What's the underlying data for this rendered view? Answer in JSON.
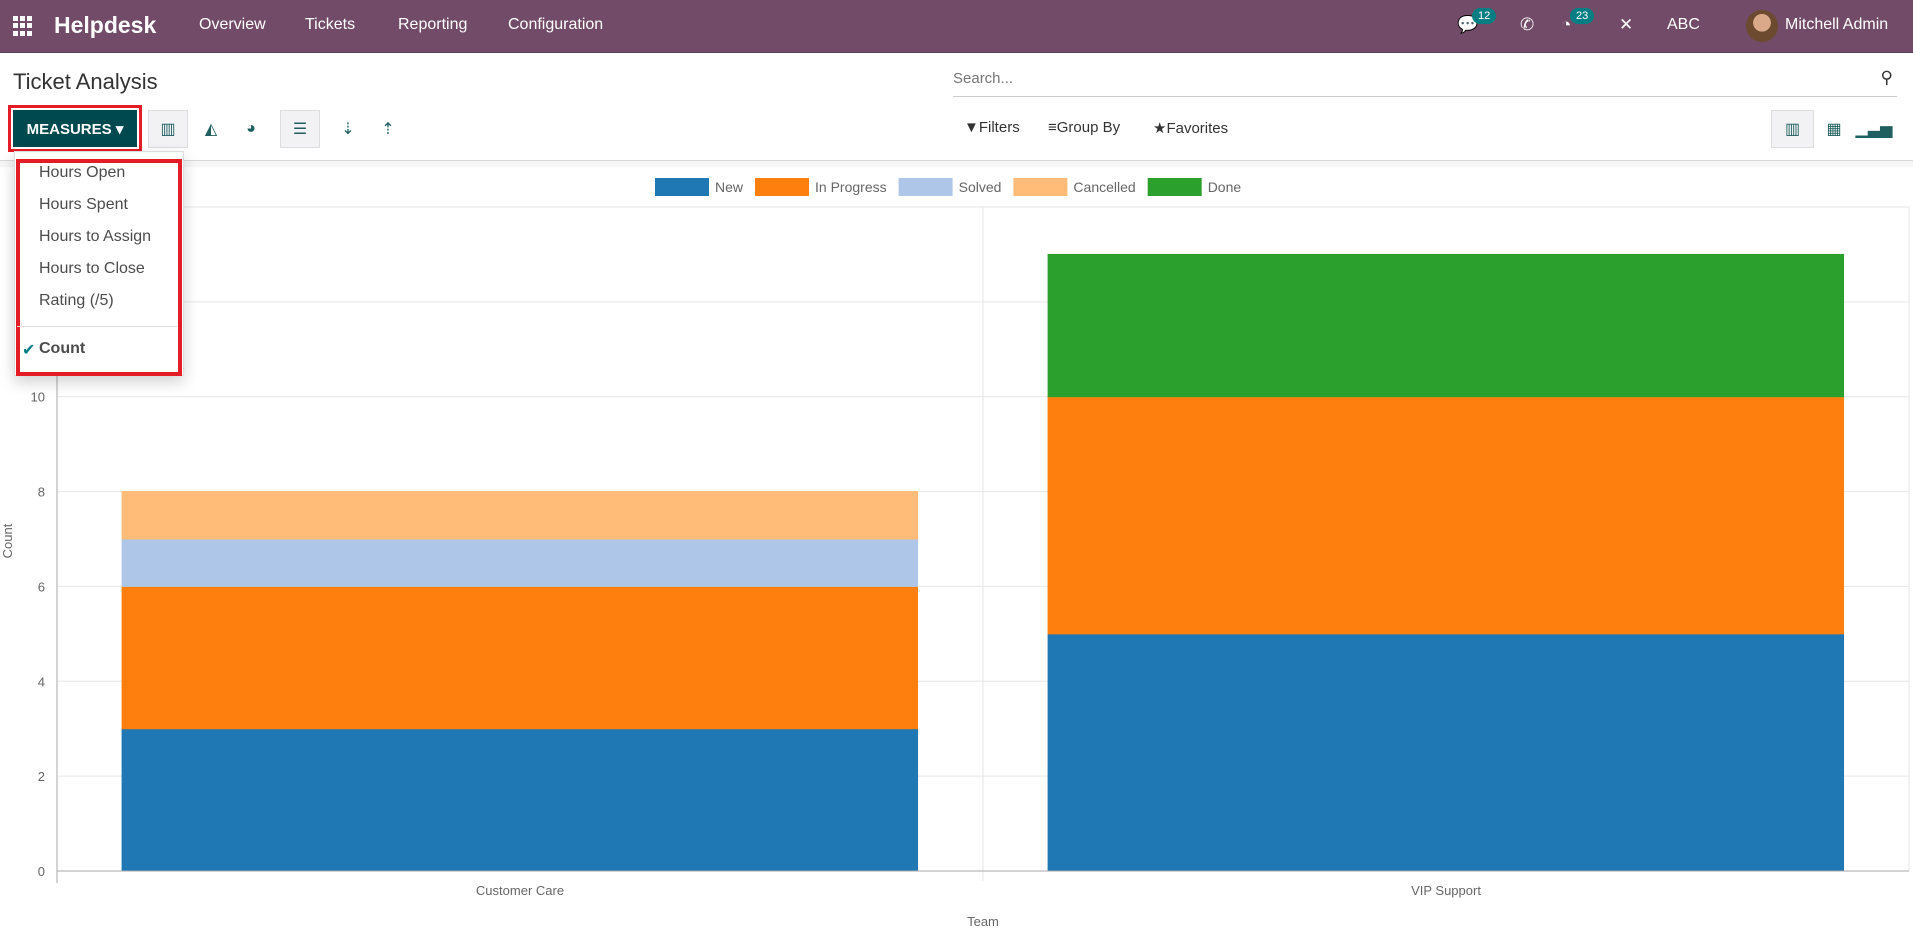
{
  "nav": {
    "brand": "Helpdesk",
    "menu": [
      "Overview",
      "Tickets",
      "Reporting",
      "Configuration"
    ],
    "messages_count": "12",
    "activities_count": "23",
    "company": "ABC",
    "user": "Mitchell Admin"
  },
  "page": {
    "title": "Ticket Analysis",
    "search_placeholder": "Search..."
  },
  "toolbar": {
    "measures_label": "MEASURES",
    "filters": "Filters",
    "group_by": "Group By",
    "favorites": "Favorites"
  },
  "measures_menu": {
    "items": [
      "Hours Open",
      "Hours Spent",
      "Hours to Assign",
      "Hours to Close",
      "Rating (/5)"
    ],
    "selected": "Count"
  },
  "colors": {
    "navbar": "#714b67",
    "primary": "#00494f",
    "highlight": "#e31c25"
  },
  "chart_data": {
    "type": "bar",
    "stacked": true,
    "categories": [
      "Customer Care",
      "VIP Support"
    ],
    "xlabel": "Team",
    "ylabel": "Count",
    "ylim": [
      0,
      14
    ],
    "yticks": [
      0,
      2,
      4,
      6,
      8,
      10,
      12,
      14
    ],
    "grid": true,
    "legend": "top",
    "series": [
      {
        "name": "New",
        "color": "#1f77b4",
        "values": [
          3,
          5
        ]
      },
      {
        "name": "In Progress",
        "color": "#ff7f0e",
        "values": [
          3,
          5
        ]
      },
      {
        "name": "Solved",
        "color": "#aec7e8",
        "values": [
          1,
          0
        ]
      },
      {
        "name": "Cancelled",
        "color": "#ffbb78",
        "values": [
          1,
          0
        ]
      },
      {
        "name": "Done",
        "color": "#2ca02c",
        "values": [
          0,
          3
        ]
      }
    ]
  }
}
